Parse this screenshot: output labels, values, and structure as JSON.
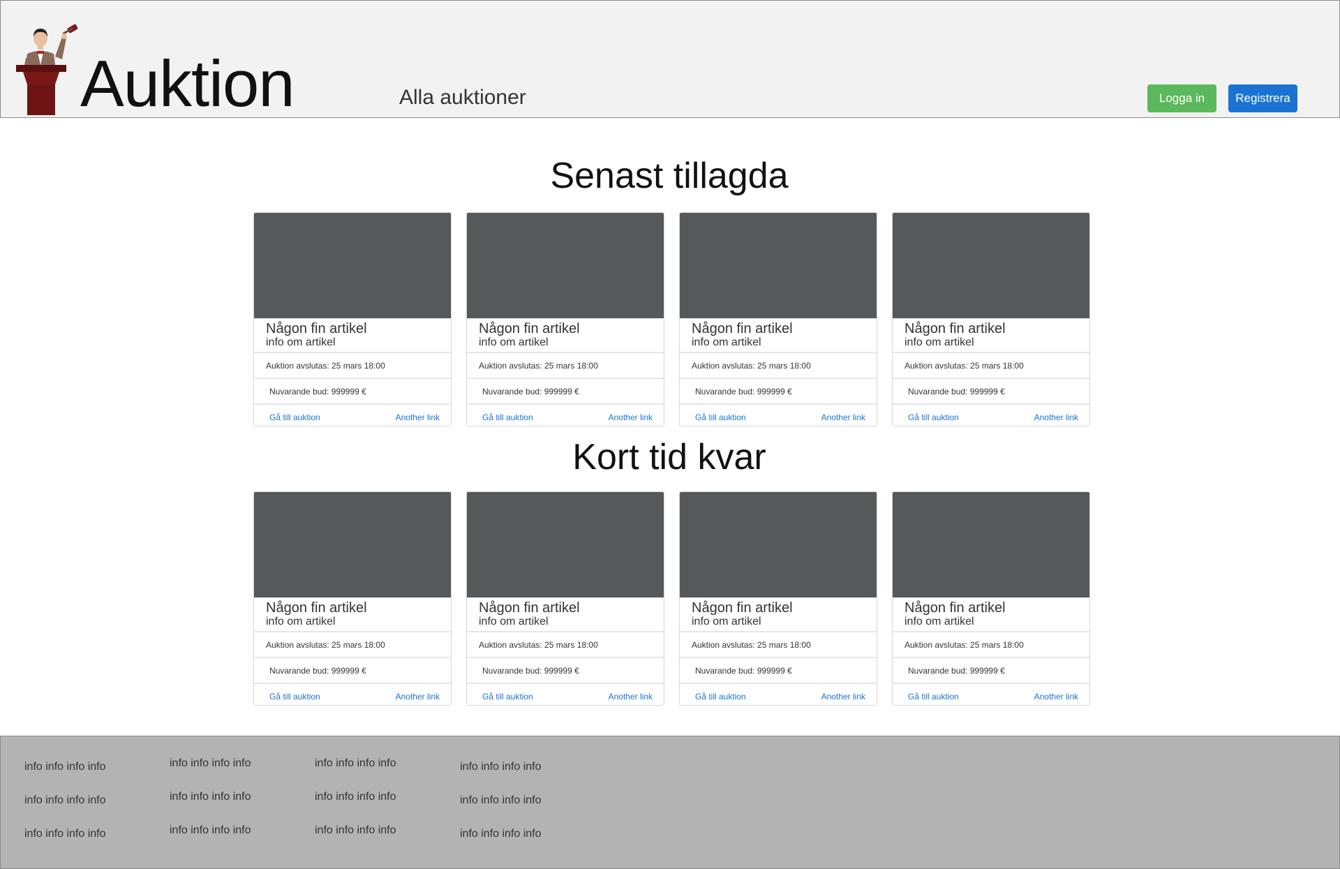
{
  "header": {
    "brand": "Auktion",
    "nav_link": "Alla auktioner",
    "login_label": "Logga in",
    "register_label": "Registrera"
  },
  "sections": [
    {
      "title": "Senast tillagda",
      "cards": [
        {
          "title": "Någon fin artikel",
          "text": "info om artikel",
          "ends": "Auktion avslutas: 25 mars 18:00",
          "bid": "Nuvarande bud: 999999 €",
          "link1": "Gå till auktion",
          "link2": "Another link"
        },
        {
          "title": "Någon fin artikel",
          "text": "info om artikel",
          "ends": "Auktion avslutas: 25 mars 18:00",
          "bid": "Nuvarande bud: 999999 €",
          "link1": "Gå till auktion",
          "link2": "Another link"
        },
        {
          "title": "Någon fin artikel",
          "text": "info om artikel",
          "ends": "Auktion avslutas: 25 mars 18:00",
          "bid": "Nuvarande bud: 999999 €",
          "link1": "Gå till auktion",
          "link2": "Another link"
        },
        {
          "title": "Någon fin artikel",
          "text": "info om artikel",
          "ends": "Auktion avslutas: 25 mars 18:00",
          "bid": "Nuvarande bud: 999999 €",
          "link1": "Gå till auktion",
          "link2": "Another link"
        }
      ]
    },
    {
      "title": "Kort tid kvar",
      "cards": [
        {
          "title": "Någon fin artikel",
          "text": "info om artikel",
          "ends": "Auktion avslutas: 25 mars 18:00",
          "bid": "Nuvarande bud: 999999 €",
          "link1": "Gå till auktion",
          "link2": "Another link"
        },
        {
          "title": "Någon fin artikel",
          "text": "info om artikel",
          "ends": "Auktion avslutas: 25 mars 18:00",
          "bid": "Nuvarande bud: 999999 €",
          "link1": "Gå till auktion",
          "link2": "Another link"
        },
        {
          "title": "Någon fin artikel",
          "text": "info om artikel",
          "ends": "Auktion avslutas: 25 mars 18:00",
          "bid": "Nuvarande bud: 999999 €",
          "link1": "Gå till auktion",
          "link2": "Another link"
        },
        {
          "title": "Någon fin artikel",
          "text": "info om artikel",
          "ends": "Auktion avslutas: 25 mars 18:00",
          "bid": "Nuvarande bud: 999999 €",
          "link1": "Gå till auktion",
          "link2": "Another link"
        }
      ]
    }
  ],
  "footer": {
    "columns": [
      [
        "info info info info",
        "info info info info",
        "info info info info"
      ],
      [
        "info info info info",
        "info info info info",
        "info info info info"
      ],
      [
        "info info info info",
        "info info info info",
        "info info info info"
      ],
      [
        "info info info info",
        "info info info info",
        "info info info info"
      ]
    ]
  },
  "colors": {
    "login": "#5cb85c",
    "register": "#1a73d2",
    "card_image": "#55595c",
    "footer_bg": "#b3b3b3",
    "header_bg": "#f2f2f2"
  },
  "icons": {
    "logo": "auctioneer-podium-icon"
  }
}
